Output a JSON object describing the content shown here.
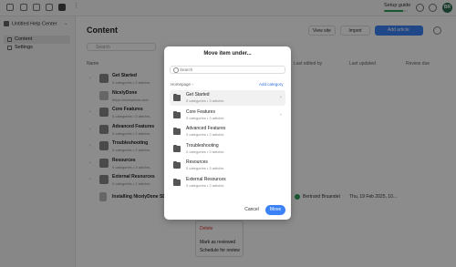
{
  "topbar": {
    "setup_label": "Setup guide",
    "setup_progress": 0.8,
    "avatar_initials": "BR"
  },
  "sidebar": {
    "workspace": "Untitled Help Center",
    "items": [
      {
        "label": "Content"
      },
      {
        "label": "Settings"
      }
    ]
  },
  "main": {
    "title": "Content",
    "view_site": "View site",
    "import": "Import",
    "add_article": "Add article",
    "search_placeholder": "Search",
    "columns": {
      "name": "Name",
      "last_edited_by": "Last edited by",
      "last_updated": "Last updated",
      "review_due": "Review due"
    },
    "rows": [
      {
        "title": "Get Started",
        "sub": "0 categories • 3 articles"
      },
      {
        "title": "NicelyDone",
        "sub": "https://nicelydone.club"
      },
      {
        "title": "Core Features",
        "sub": "0 categories • 3 articles"
      },
      {
        "title": "Advanced Features",
        "sub": "0 categories • 2 articles"
      },
      {
        "title": "Troubleshooting",
        "sub": "0 categories • 3 articles"
      },
      {
        "title": "Resources",
        "sub": "0 categories • 3 articles"
      },
      {
        "title": "External Resources",
        "sub": "0 categories • 2 articles"
      },
      {
        "title": "Installing NicelyDone SDK",
        "sub": ""
      }
    ],
    "edited_by": "Bertrand Bruandet",
    "updated": "Thu, 19 Feb 2025, 10..."
  },
  "menu": {
    "items": [
      "Delete",
      "Mark as reviewed",
      "Schedule for review"
    ]
  },
  "dialog": {
    "title": "Move item under...",
    "search_placeholder": "Search",
    "breadcrumb": "Homepage ›",
    "add_category": "Add category",
    "items": [
      {
        "title": "Get Started",
        "sub": "0 categories • 3 articles",
        "arrow": "›"
      },
      {
        "title": "Core Features",
        "sub": "0 categories • 3 articles",
        "arrow": "›"
      },
      {
        "title": "Advanced Features",
        "sub": "0 categories • 2 articles",
        "arrow": ""
      },
      {
        "title": "Troubleshooting",
        "sub": "0 categories • 3 articles",
        "arrow": ""
      },
      {
        "title": "Resources",
        "sub": "0 categories • 3 articles",
        "arrow": ""
      },
      {
        "title": "External Resources",
        "sub": "0 categories • 2 articles",
        "arrow": ""
      }
    ],
    "cancel": "Cancel",
    "move": "Move"
  },
  "colors": {
    "accent": "#3b82f6",
    "overlay": "rgba(0,0,0,0.45)"
  }
}
